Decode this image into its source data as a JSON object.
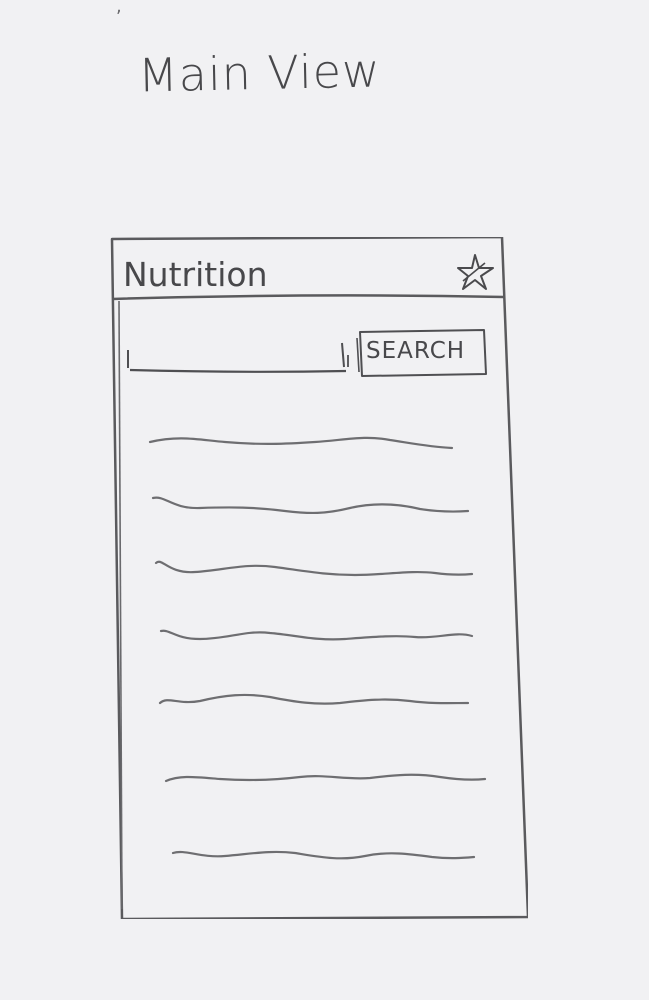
{
  "sheet": {
    "title": "Main View"
  },
  "app": {
    "title": "Nutrition",
    "favorite_icon": "star-icon"
  },
  "search": {
    "value": "",
    "placeholder": "",
    "button_label": "SEARCH"
  },
  "results": [
    {
      "placeholder": "squiggle"
    },
    {
      "placeholder": "squiggle"
    },
    {
      "placeholder": "squiggle"
    },
    {
      "placeholder": "squiggle"
    },
    {
      "placeholder": "squiggle"
    },
    {
      "placeholder": "squiggle"
    },
    {
      "placeholder": "squiggle"
    }
  ],
  "colors": {
    "paper": "#f1f1f3",
    "pencil": "#4f4f52"
  }
}
